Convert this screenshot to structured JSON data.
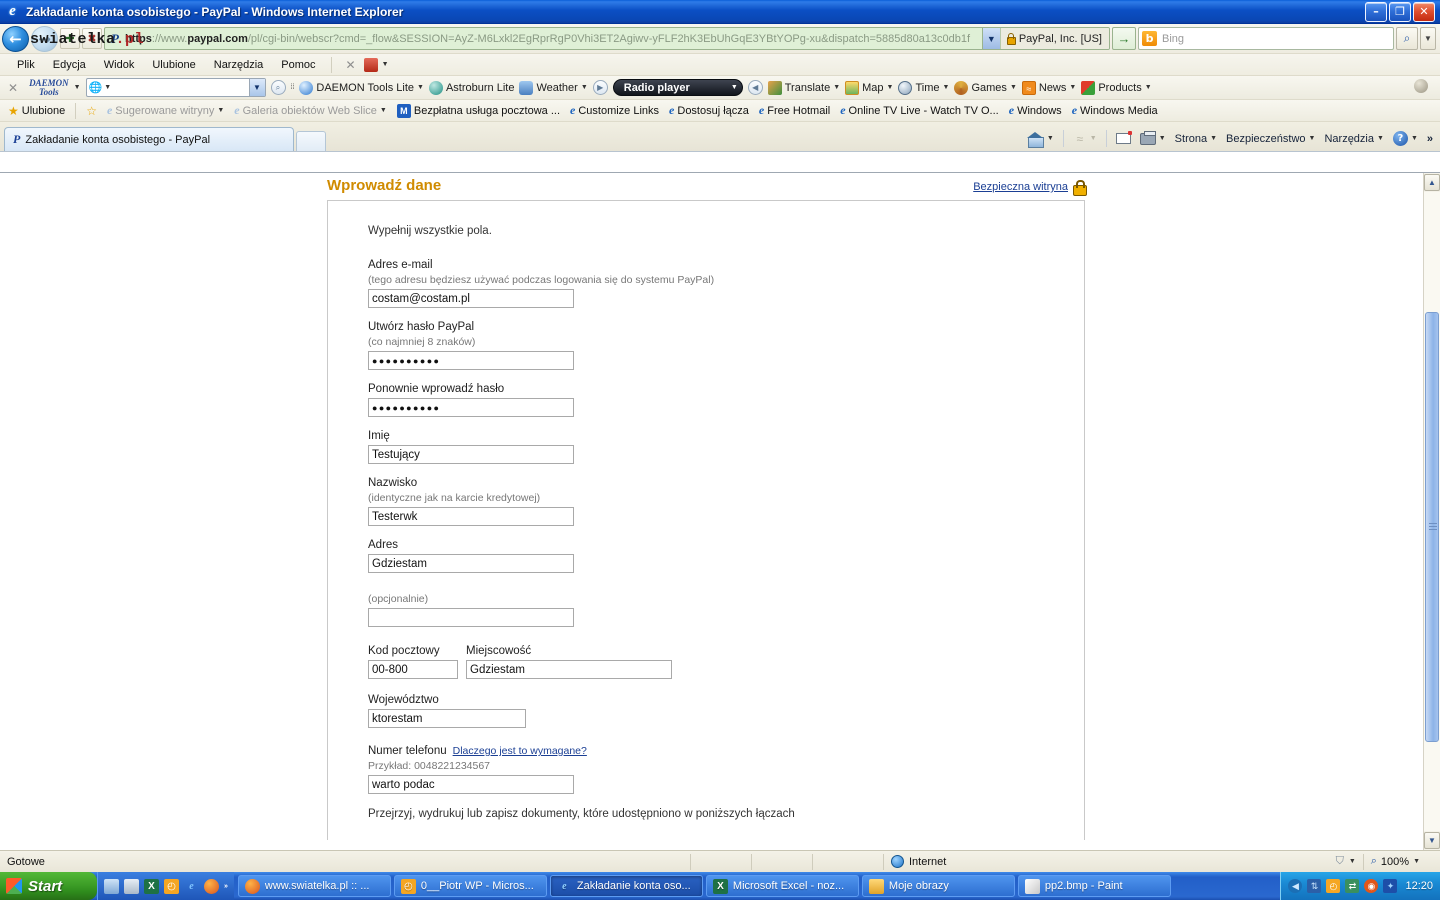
{
  "window": {
    "title": "Zakładanie konta osobistego - PayPal - Windows Internet Explorer",
    "app_icon": "ie-icon",
    "minimize": "–",
    "restore": "❐",
    "close": "✕"
  },
  "navbar": {
    "back_icon": "back-arrow-icon",
    "forward_icon": "forward-arrow-icon",
    "site_logo": "swiatelka",
    "site_logo_suffix": ".pl",
    "url_scheme": "https",
    "url_sep": "://www.",
    "url_host": "paypal.com",
    "url_path": "/pl/cgi-bin/webscr?cmd=_flow&SESSION=AyZ-M6Lxkl2EgRprRgP0Vhi3ET2Agiwv-yFLF2hK3EbUhGqE3YBtYOPg-xu&dispatch=5885d80a13c0db1f",
    "cert_label": "PayPal, Inc. [US]",
    "go_label": "→",
    "search_placeholder": "Bing",
    "search_value": "",
    "bing_glyph": "b"
  },
  "menubar": {
    "items": [
      "Plik",
      "Edycja",
      "Widok",
      "Ulubione",
      "Narzędzia",
      "Pomoc"
    ],
    "close_x": "✕",
    "pdf_label": ""
  },
  "daemon_toolbar": {
    "close_x": "✕",
    "brand_line1": "DAEMON",
    "brand_line2": "Tools",
    "search_value": "",
    "items": [
      {
        "label": "DAEMON Tools Lite",
        "icon": "daemon-icon",
        "has_caret": true
      },
      {
        "label": "Astroburn Lite",
        "icon": "astroburn-icon",
        "has_caret": false
      },
      {
        "label": "Weather",
        "icon": "weather-icon",
        "has_caret": true
      },
      {
        "label": "Radio player",
        "icon": "radio-icon",
        "has_caret": true
      },
      {
        "label": "Translate",
        "icon": "translate-icon",
        "has_caret": true
      },
      {
        "label": "Map",
        "icon": "map-icon",
        "has_caret": true
      },
      {
        "label": "Time",
        "icon": "clock-icon",
        "has_caret": true
      },
      {
        "label": "Games",
        "icon": "games-icon",
        "has_caret": true
      },
      {
        "label": "News",
        "icon": "rss-icon",
        "has_caret": true
      },
      {
        "label": "Products",
        "icon": "products-icon",
        "has_caret": true
      }
    ]
  },
  "favorites_bar": {
    "favorites_label": "Ulubione",
    "items": [
      {
        "label": "Sugerowane witryny",
        "dimmed": true,
        "caret": true
      },
      {
        "label": "Galeria obiektów Web Slice",
        "dimmed": true,
        "caret": true
      },
      {
        "label": "Bezpłatna usługa pocztowa ...",
        "dimmed": false,
        "caret": false
      },
      {
        "label": "Customize Links",
        "dimmed": false,
        "caret": false
      },
      {
        "label": "Dostosuj łącza",
        "dimmed": false,
        "caret": false
      },
      {
        "label": "Free Hotmail",
        "dimmed": false,
        "caret": false
      },
      {
        "label": "Online TV Live - Watch TV O...",
        "dimmed": false,
        "caret": false
      },
      {
        "label": "Windows",
        "dimmed": false,
        "caret": false
      },
      {
        "label": "Windows Media",
        "dimmed": false,
        "caret": false
      }
    ]
  },
  "tabs": {
    "active_tab": "Zakładanie konta osobistego - PayPal",
    "new_tab_tooltip": ""
  },
  "command_bar": {
    "home_label": "",
    "page_label": "Strona",
    "security_label": "Bezpieczeństwo",
    "tools_label": "Narzędzia",
    "help_label": "",
    "overflow": "»"
  },
  "page": {
    "title": "Wprowadź dane",
    "secure_link": "Bezpieczna witryna",
    "intro": "Wypełnij wszystkie pola.",
    "fields": [
      {
        "name": "email",
        "label": "Adres e-mail",
        "sublabel": "(tego adresu będziesz używać podczas logowania się do systemu PayPal)",
        "value": "costam@costam.pl",
        "width": "full",
        "masked": false
      },
      {
        "name": "password",
        "label": "Utwórz hasło PayPal",
        "sublabel": "(co najmniej 8 znaków)",
        "value": "●●●●●●●●●●",
        "width": "full",
        "masked": true
      },
      {
        "name": "password-confirm",
        "label": "Ponownie wprowadź hasło",
        "sublabel": "",
        "value": "●●●●●●●●●●",
        "width": "full",
        "masked": true
      },
      {
        "name": "first-name",
        "label": "Imię",
        "sublabel": "",
        "value": "Testujący",
        "width": "full",
        "masked": false
      },
      {
        "name": "last-name",
        "label": "Nazwisko",
        "sublabel": "(identyczne jak na karcie kredytowej)",
        "value": "Testerwk",
        "width": "full",
        "masked": false
      },
      {
        "name": "address1",
        "label": "Adres",
        "sublabel": "",
        "value": "Gdziestam",
        "width": "full",
        "masked": false
      },
      {
        "name": "address2",
        "label": "",
        "sublabel": "(opcjonalnie)",
        "value": "",
        "width": "full",
        "masked": false
      }
    ],
    "zip_label": "Kod pocztowy",
    "zip_value": "00-800",
    "city_label": "Miejscowość",
    "city_value": "Gdziestam",
    "voivodeship_label": "Województwo",
    "voivodeship_value": "ktorestam",
    "phone_label": "Numer telefonu",
    "phone_help_link": "Dlaczego jest to wymagane?",
    "phone_example": "Przykład: 0048221234567",
    "phone_value": "warto podac",
    "documents_note": "Przejrzyj, wydrukuj lub zapisz dokumenty, które udostępniono w poniższych łączach"
  },
  "status_bar": {
    "status": "Gotowe",
    "zone": "Internet",
    "zoom": "100%",
    "protected_icon": "shield-icon"
  },
  "taskbar": {
    "start_label": "Start",
    "quick_launch": [
      "show-desktop-icon",
      "media-icon",
      "excel-icon",
      "clock-icon",
      "ie-icon",
      "firefox-icon"
    ],
    "overflow": "»",
    "tasks": [
      {
        "label": "www.swiatelka.pl :: ...",
        "icon": "firefox-icon",
        "active": false
      },
      {
        "label": "0__Piotr WP - Micros...",
        "icon": "outlook-icon",
        "active": false
      },
      {
        "label": "Zakładanie konta oso...",
        "icon": "ie-icon",
        "active": true
      },
      {
        "label": "Microsoft Excel - noz...",
        "icon": "excel-icon",
        "active": false
      },
      {
        "label": "Moje obrazy",
        "icon": "folder-icon",
        "active": false
      },
      {
        "label": "pp2.bmp - Paint",
        "icon": "paint-icon",
        "active": false
      }
    ],
    "tray_icons": [
      "show-hidden-icon",
      "network-icon",
      "clock-tray-icon",
      "sync-icon",
      "antivirus-icon",
      "bluetooth-icon"
    ],
    "clock": "12:20"
  },
  "colors": {
    "title_accent": "#d08b00",
    "link": "#1b3f94",
    "taskbar_blue": "#225fc8",
    "start_green": "#3d9e27"
  }
}
